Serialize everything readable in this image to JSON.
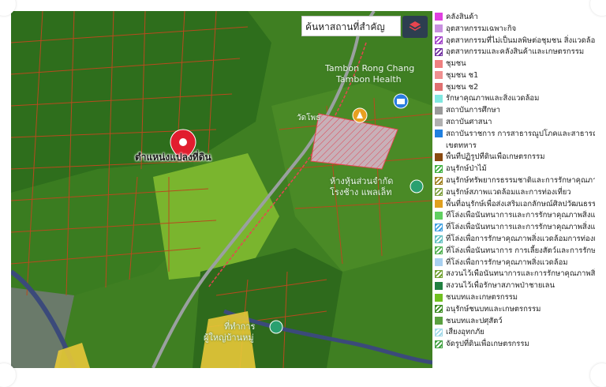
{
  "map": {
    "search_placeholder": "ค้นหาสถานที่สำคัญ",
    "pin_label": "ตำแหน่งแปลงที่ดิน",
    "labels": {
      "tambon_rong_chang": "Tambon Rong Chang",
      "tambon_health": "Tambon Health",
      "wat_phra": "วัดโพธ",
      "store_1": "ห้างหุ้นส่วนจำกัด",
      "store_2": "โรงช้าง แพลเล็ท",
      "office_1": "ที่ทำการ",
      "office_2": "ผู้ใหญ่บ้านหมู่"
    },
    "colors": {
      "field_dark": "#2f6f1e",
      "field_light": "#5a9a2a",
      "parcel_line": "#b84a1e",
      "road": "#9aa0a0",
      "zone_line": "#e8454f",
      "pin": "#e11d2e",
      "water": "#3b4a7a",
      "built_area": "#c9b8c0",
      "yellow_zone": "#e8c838"
    }
  },
  "legend": {
    "items": [
      {
        "label": "คลังสินค้า",
        "color": "#e040e0",
        "style": "solid"
      },
      {
        "label": "อุตสาหกรรมเฉพาะกิจ",
        "color": "#c890e0",
        "style": "solid"
      },
      {
        "label": "อุตสาหกรรมที่ไม่เป็นมลพิษต่อชุมชน สิ่งแวดล้อม",
        "color": "#a040c8",
        "style": "hatch"
      },
      {
        "label": "อุตสาหกรรมและคลังสินค้าและเกษตรกรรม",
        "color": "#7030a0",
        "style": "hatch"
      },
      {
        "label": "ชุมชน",
        "color": "#f08080",
        "style": "solid"
      },
      {
        "label": "ชุมชน ช1",
        "color": "#f09090",
        "style": "solid"
      },
      {
        "label": "ชุมชน ช2",
        "color": "#e07070",
        "style": "solid"
      },
      {
        "label": "รักษาคุณภาพและสิ่งแวดล้อม",
        "color": "#80e8e0",
        "style": "solid"
      },
      {
        "label": "สถาบันการศึกษา",
        "color": "#9a9a9a",
        "style": "solid"
      },
      {
        "label": "สถาบันศาสนา",
        "color": "#b0b0b0",
        "style": "solid"
      },
      {
        "label": "สถาบันราชการ การสาธารณูปโภคและสาธารณูปการ",
        "color": "#2080e0",
        "style": "solid"
      },
      {
        "label": "เขตทหาร",
        "color": "#ffffff",
        "style": "none"
      },
      {
        "label": "พื้นที่ปฏิรูปที่ดินเพื่อเกษตรกรรม",
        "color": "#8a4a10",
        "style": "solid"
      },
      {
        "label": "อนุรักษ์ป่าไม้",
        "color": "#40b040",
        "style": "hatch"
      },
      {
        "label": "อนุรักษ์ทรัพยากรธรรมชาติและการรักษาคุณภาพ",
        "color": "#a08020",
        "style": "hatch"
      },
      {
        "label": "อนุรักษ์สภาพแวดล้อมและการท่องเที่ยว",
        "color": "#80a040",
        "style": "hatch"
      },
      {
        "label": "พื้นที่อนุรักษ์เพื่อส่งเสริมเอกลักษณ์ศิลปวัฒนธรรม",
        "color": "#e0a020",
        "style": "solid"
      },
      {
        "label": "ที่โล่งเพื่อนันทนาการและการรักษาคุณภาพสิ่งแวดล้อม",
        "color": "#60d060",
        "style": "solid"
      },
      {
        "label": "ที่โล่งเพื่อนันทนาการและการรักษาคุณภาพสิ่งแวดล้อม",
        "color": "#40a0e0",
        "style": "hatch"
      },
      {
        "label": "ที่โล่งเพื่อการรักษาคุณภาพสิ่งแวดล้อมการท่องเที่ยว",
        "color": "#60c0c0",
        "style": "hatch"
      },
      {
        "label": "ที่โล่งเพื่อนันทนาการ การเลี้ยงสัตว์และการรักษา",
        "color": "#50b050",
        "style": "hatch"
      },
      {
        "label": "ที่โล่งเพื่อการรักษาคุณภาพสิ่งแวดล้อม",
        "color": "#a8d0f0",
        "style": "solid"
      },
      {
        "label": "สงวนไว้เพื่อนันทนาการและการรักษาคุณภาพสิ่ง",
        "color": "#70a030",
        "style": "hatch"
      },
      {
        "label": "สงวนไว้เพื่อรักษาสภาพป่าชายเลน",
        "color": "#208040",
        "style": "solid"
      },
      {
        "label": "ชนบทและเกษตรกรรม",
        "color": "#70c020",
        "style": "solid"
      },
      {
        "label": "อนุรักษ์ชนบทและเกษตรกรรม",
        "color": "#3a8a20",
        "style": "hatch"
      },
      {
        "label": "ชนบทและปศุสัตว์",
        "color": "#5aa040",
        "style": "solid"
      },
      {
        "label": "เสี่ยงอุทกภัย",
        "color": "#a0d8e8",
        "style": "hatch"
      },
      {
        "label": "จัดรูปที่ดินเพื่อเกษตรกรรม",
        "color": "#40a040",
        "style": "hatch"
      }
    ]
  }
}
